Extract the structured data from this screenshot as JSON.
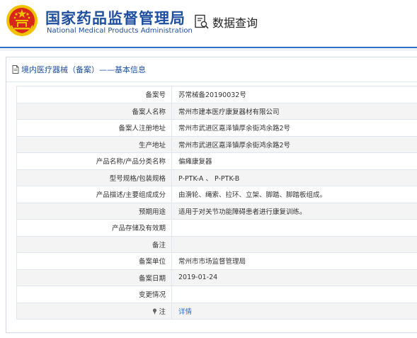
{
  "header": {
    "org_name_cn": "国家药品监督管理局",
    "org_name_en": "National Medical Products Administration",
    "query_label": "数据查询"
  },
  "colors": {
    "brand_blue": "#1f4fa0",
    "link_blue": "#1f6fd1",
    "emblem_red": "#d7261b",
    "emblem_gold": "#f2c200"
  },
  "panel": {
    "title": "境内医疗器械（备案）——基本信息"
  },
  "rows": [
    {
      "label": "备案号",
      "value": "苏常械备20190032号"
    },
    {
      "label": "备案人名称",
      "value": "常州市建本医疗康复器材有限公司"
    },
    {
      "label": "备案人注册地址",
      "value": "常州市武进区嘉泽镇厚余街鸿余路2号"
    },
    {
      "label": "生产地址",
      "value": "常州市武进区嘉泽镇厚余街鸿余路2号"
    },
    {
      "label": "产品名称/产品分类名称",
      "value": "偏瘫康复器"
    },
    {
      "label": "型号规格/包装规格",
      "value": "P-PTK-A 、 P-PTK-B"
    },
    {
      "label": "产品描述/主要组成成分",
      "value": "由滑轮、绳索、拉环、立架、脚踏、脚踏板组成。"
    },
    {
      "label": "预期用途",
      "value": "适用于对关节功能障碍患者进行康复训练。"
    },
    {
      "label": "产品存储及有效期",
      "value": ""
    },
    {
      "label": "备注",
      "value": ""
    },
    {
      "label": "备案单位",
      "value": "常州市市场监督管理局"
    },
    {
      "label": "备案日期",
      "value": "2019-01-24"
    },
    {
      "label": "变更情况",
      "value": ""
    },
    {
      "label": "注",
      "value": "详情"
    }
  ]
}
